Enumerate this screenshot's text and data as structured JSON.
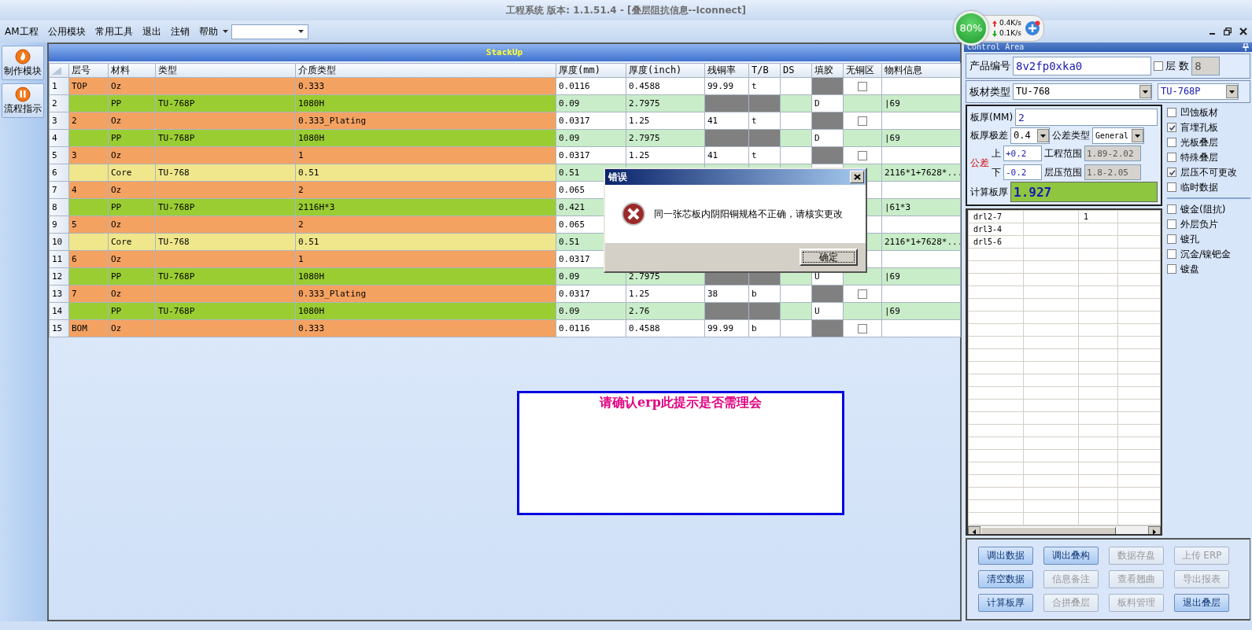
{
  "window": {
    "title": "工程系统  版本: 1.1.51.4 - [叠层阻抗信息--Iconnect]"
  },
  "menu": {
    "items": [
      "AM工程",
      "公用模块",
      "常用工具",
      "退出",
      "注销",
      "帮助"
    ]
  },
  "network_widget": {
    "percent": "80%",
    "upload": "0.4K/s",
    "download": "0.1K/s"
  },
  "sidebar": {
    "items": [
      {
        "label": "制作模块"
      },
      {
        "label": "流程指示"
      }
    ]
  },
  "stackup": {
    "title": "StackUp",
    "columns": [
      "层号",
      "材料",
      "类型",
      "介质类型",
      "厚度(mm)",
      "厚度(inch)",
      "残铜率",
      "T/B",
      "DS",
      "填胶",
      "无铜区",
      "物料信息"
    ],
    "rows": [
      {
        "no": "1",
        "kind": "copper",
        "layer": "TOP",
        "material": "Oz",
        "dielectric": "0.333",
        "thk_mm": "0.0116",
        "thk_inch": "0.4588",
        "residual_cu": "99.99",
        "tb": "t",
        "no_cu_checked": false
      },
      {
        "no": "2",
        "kind": "prepreg",
        "material": "PP",
        "type": "TU-768P",
        "dielectric": "1080H",
        "thk_mm": "0.09",
        "thk_inch": "2.7975",
        "fill": "D",
        "info": "|69"
      },
      {
        "no": "3",
        "kind": "copper",
        "layer": "2",
        "material": "Oz",
        "dielectric": "0.333_Plating",
        "thk_mm": "0.0317",
        "thk_inch": "1.25",
        "residual_cu": "41",
        "tb": "t",
        "no_cu_checked": false
      },
      {
        "no": "4",
        "kind": "prepreg",
        "material": "PP",
        "type": "TU-768P",
        "dielectric": "1080H",
        "thk_mm": "0.09",
        "thk_inch": "2.7975",
        "fill": "D",
        "info": "|69"
      },
      {
        "no": "5",
        "kind": "copper",
        "layer": "3",
        "material": "Oz",
        "dielectric": "1",
        "thk_mm": "0.0317",
        "thk_inch": "1.25",
        "residual_cu": "41",
        "tb": "t",
        "no_cu_checked": false
      },
      {
        "no": "6",
        "kind": "core",
        "material": "Core",
        "type": "TU-768",
        "dielectric": "0.51",
        "thk_mm": "0.51",
        "info": "2116*1+7628*..."
      },
      {
        "no": "7",
        "kind": "copper",
        "layer": "4",
        "material": "Oz",
        "dielectric": "2",
        "thk_mm": "0.065"
      },
      {
        "no": "8",
        "kind": "prepreg",
        "material": "PP",
        "type": "TU-768P",
        "dielectric": "2116H*3",
        "thk_mm": "0.421",
        "info": "|61*3"
      },
      {
        "no": "9",
        "kind": "copper",
        "layer": "5",
        "material": "Oz",
        "dielectric": "2",
        "thk_mm": "0.065"
      },
      {
        "no": "10",
        "kind": "core",
        "material": "Core",
        "type": "TU-768",
        "dielectric": "0.51",
        "thk_mm": "0.51",
        "info": "2116*1+7628*..."
      },
      {
        "no": "11",
        "kind": "copper",
        "layer": "6",
        "material": "Oz",
        "dielectric": "1",
        "thk_mm": "0.0317"
      },
      {
        "no": "12",
        "kind": "prepreg",
        "material": "PP",
        "type": "TU-768P",
        "dielectric": "1080H",
        "thk_mm": "0.09",
        "thk_inch": "2.7975",
        "fill": "U",
        "info": "|69"
      },
      {
        "no": "13",
        "kind": "copper",
        "layer": "7",
        "material": "Oz",
        "dielectric": "0.333_Plating",
        "thk_mm": "0.0317",
        "thk_inch": "1.25",
        "residual_cu": "38",
        "tb": "b",
        "no_cu_checked": false
      },
      {
        "no": "14",
        "kind": "prepreg",
        "material": "PP",
        "type": "TU-768P",
        "dielectric": "1080H",
        "thk_mm": "0.09",
        "thk_inch": "2.76",
        "fill": "U",
        "info": "|69"
      },
      {
        "no": "15",
        "kind": "copper",
        "layer": "BOM",
        "material": "Oz",
        "dielectric": "0.333",
        "thk_mm": "0.0116",
        "thk_inch": "0.4588",
        "residual_cu": "99.99",
        "tb": "b",
        "no_cu_checked": false
      }
    ]
  },
  "error_dialog": {
    "title": "错误",
    "message": "同一张芯板内阴阳铜规格不正确，请核实更改",
    "button": "确定"
  },
  "note_box": {
    "text": "请确认erp此提示是否需理会"
  },
  "control_area": {
    "title": "Control Area",
    "product": {
      "label": "产品编号",
      "value": "8v2fp0xka0"
    },
    "layers": {
      "checked": false,
      "label": "层  数",
      "value": "8",
      "disabled": true
    },
    "material": {
      "label": "板材类型",
      "core": "TU-768",
      "prepreg": "TU-768P"
    },
    "thickness": {
      "label": "板厚(MM)",
      "value": "2"
    },
    "range": {
      "label": "板厚极差",
      "value": "0.4"
    },
    "tolerance_type": {
      "label": "公差类型",
      "value": "General"
    },
    "tolerance": {
      "label": "公差",
      "upper_label": "上",
      "upper": "+0.2",
      "lower_label": "下",
      "lower": "-0.2"
    },
    "eng_range": {
      "label": "工程范围",
      "value": "1.89-2.02",
      "disabled": true
    },
    "press_range": {
      "label": "层压范围",
      "value": "1.8-2.05",
      "disabled": true
    },
    "calc": {
      "label": "计算板厚",
      "value": "1.927"
    },
    "options": [
      {
        "label": "凹蚀板材",
        "checked": false
      },
      {
        "label": "盲埋孔板",
        "checked": true
      },
      {
        "label": "光板叠层",
        "checked": false
      },
      {
        "label": "特殊叠层",
        "checked": false
      },
      {
        "label": "层压不可更改",
        "checked": true
      },
      {
        "label": "临时数据",
        "checked": false
      }
    ],
    "plating_options": [
      {
        "label": "镀金(阻抗)",
        "checked": false
      },
      {
        "label": "外层负片",
        "checked": false
      },
      {
        "label": "镀孔",
        "checked": false
      },
      {
        "label": "沉金/镍钯金",
        "checked": false
      },
      {
        "label": "镀盘",
        "checked": false
      }
    ],
    "drill_rows": [
      {
        "column_1": "drl2-7",
        "column_3": "1"
      },
      {
        "column_1": "drl3-4"
      },
      {
        "column_1": "drl5-6"
      }
    ],
    "buttons": [
      {
        "label": "调出数据",
        "disabled": false
      },
      {
        "label": "调出叠构",
        "disabled": false
      },
      {
        "label": "数据存盘",
        "disabled": true
      },
      {
        "label": "上传 ERP",
        "disabled": true
      },
      {
        "label": "清空数据",
        "disabled": false
      },
      {
        "label": "信息备注",
        "disabled": true
      },
      {
        "label": "查看翘曲",
        "disabled": true
      },
      {
        "label": "导出报表",
        "disabled": true
      },
      {
        "label": "计算板厚",
        "disabled": false
      },
      {
        "label": "合拼叠层",
        "disabled": true
      },
      {
        "label": "板料管理",
        "disabled": true
      },
      {
        "label": "退出叠层",
        "disabled": false
      }
    ]
  }
}
